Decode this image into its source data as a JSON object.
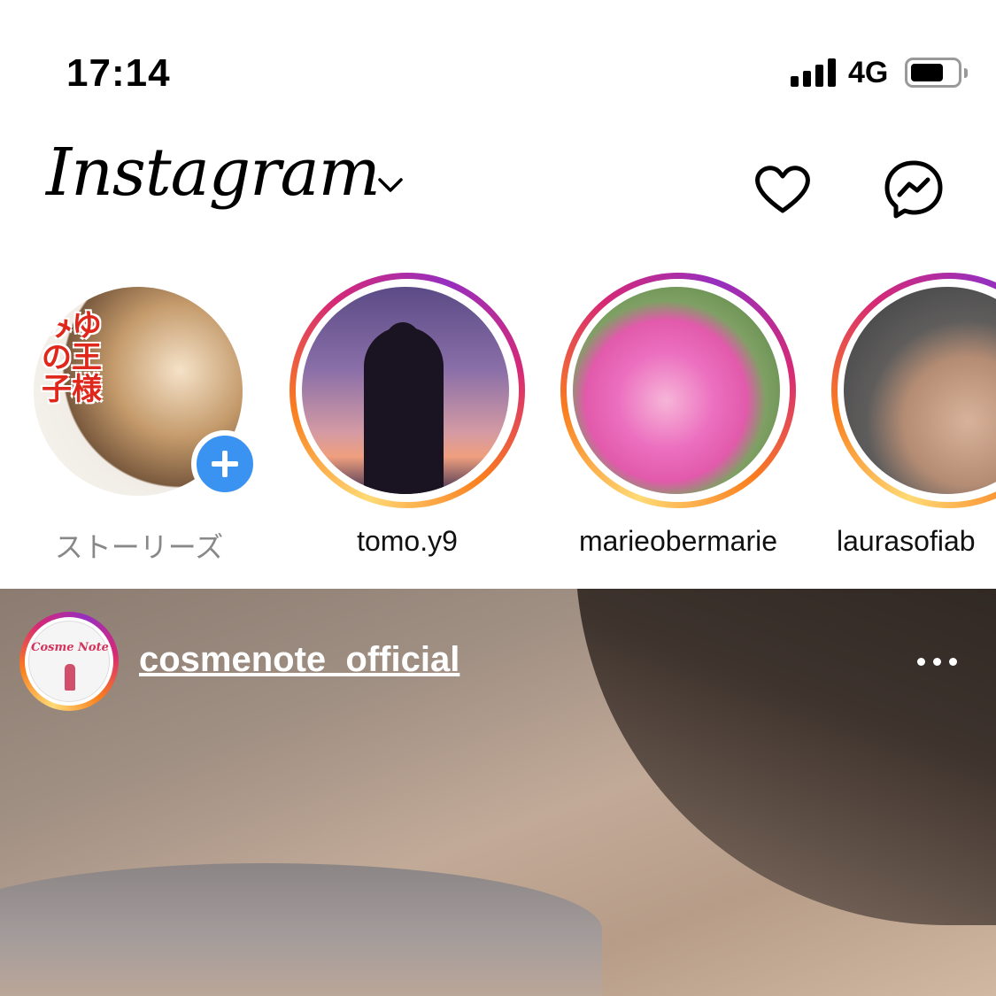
{
  "status_bar": {
    "time": "17:14",
    "network": "4G",
    "signal_bars": 4,
    "battery_level": 0.7
  },
  "header": {
    "logo": "Instagram",
    "dropdown_icon": "chevron-down-icon",
    "activity_icon": "heart-icon",
    "direct_icon": "messenger-icon"
  },
  "stories": {
    "items": [
      {
        "username": "ストーリーズ",
        "own": true,
        "avatar_text": "みゆの王子様"
      },
      {
        "username": "tomo.y9"
      },
      {
        "username": "marieobermarie"
      },
      {
        "username": "laurasofiab"
      }
    ]
  },
  "post": {
    "username": "cosmenote_official",
    "avatar_logo_text": "Cosme Note",
    "more_icon": "more-options-icon"
  },
  "colors": {
    "story_ring_start": "#feda75",
    "story_ring_mid": "#d62976",
    "story_ring_end": "#962fbf",
    "add_badge": "#3a93f0"
  }
}
